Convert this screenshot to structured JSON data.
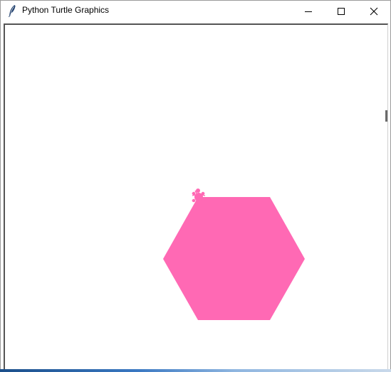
{
  "window": {
    "title": "Python Turtle Graphics",
    "icon": "feather-icon",
    "controls": {
      "minimize": "minimize-icon",
      "maximize": "maximize-icon",
      "close": "close-icon"
    }
  },
  "canvas": {
    "background": "#ffffff",
    "shape": {
      "type": "hexagon",
      "fill": "#ff69b4"
    },
    "turtle": {
      "icon": "turtle-icon",
      "color": "#ff69b4"
    }
  }
}
